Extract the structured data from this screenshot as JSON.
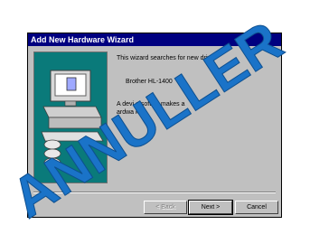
{
  "window": {
    "title": "Add New Hardware Wizard"
  },
  "content": {
    "intro": "This wizard searches for new drive",
    "device": "Brother HL-1400",
    "body_line1": "A devi    e   softwa    makes a",
    "body_line2": "ardwa       k."
  },
  "buttons": {
    "back": "< Back",
    "next": "Next >",
    "cancel": "Cancel"
  },
  "overlay": {
    "stamp_text": "ANNULLER",
    "color": "#1a73c8"
  },
  "colors": {
    "titlebar": "#000080",
    "dialog_bg": "#c0c0c0",
    "panel": "#0a7a7a"
  },
  "icons": [
    "computer-illustration",
    "cd-discs-illustration"
  ]
}
